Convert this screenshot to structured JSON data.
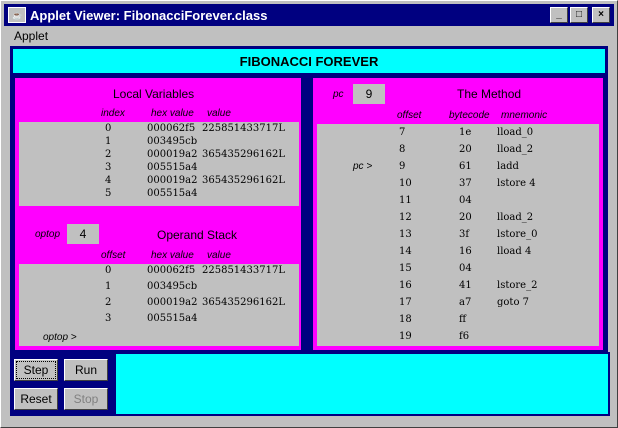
{
  "window": {
    "title": "Applet Viewer: FibonacciForever.class",
    "icon": "java-applet-icon",
    "controls": {
      "minimize": "_",
      "maximize": "□",
      "close": "×"
    }
  },
  "menu": {
    "applet": "Applet"
  },
  "banner": "FIBONACCI FOREVER",
  "local_vars": {
    "title": "Local Variables",
    "headers": {
      "index": "index",
      "hex": "hex value",
      "value": "value"
    },
    "rows": [
      {
        "index": "0",
        "hex": "000062f5",
        "value": "225851433717L"
      },
      {
        "index": "1",
        "hex": "003495cb",
        "value": ""
      },
      {
        "index": "2",
        "hex": "000019a2",
        "value": "365435296162L"
      },
      {
        "index": "3",
        "hex": "005515a4",
        "value": ""
      },
      {
        "index": "4",
        "hex": "000019a2",
        "value": "365435296162L"
      },
      {
        "index": "5",
        "hex": "005515a4",
        "value": ""
      }
    ]
  },
  "operand_stack": {
    "title": "Operand Stack",
    "optop_label": "optop",
    "optop_value": "4",
    "pointer_label": "optop >",
    "headers": {
      "offset": "offset",
      "hex": "hex value",
      "value": "value"
    },
    "rows": [
      {
        "offset": "0",
        "hex": "000062f5",
        "value": "225851433717L"
      },
      {
        "offset": "1",
        "hex": "003495cb",
        "value": ""
      },
      {
        "offset": "2",
        "hex": "000019a2",
        "value": "365435296162L"
      },
      {
        "offset": "3",
        "hex": "005515a4",
        "value": ""
      }
    ]
  },
  "method": {
    "title": "The Method",
    "pc_label": "pc",
    "pc_value": "9",
    "pointer_label": "pc >",
    "headers": {
      "offset": "offset",
      "bytecode": "bytecode",
      "mnemonic": "mnemonic"
    },
    "rows": [
      {
        "offset": "7",
        "bytecode": "1e",
        "mnemonic": "lload_0"
      },
      {
        "offset": "8",
        "bytecode": "20",
        "mnemonic": "lload_2"
      },
      {
        "offset": "9",
        "bytecode": "61",
        "mnemonic": "ladd"
      },
      {
        "offset": "10",
        "bytecode": "37",
        "mnemonic": "lstore 4"
      },
      {
        "offset": "11",
        "bytecode": "04",
        "mnemonic": ""
      },
      {
        "offset": "12",
        "bytecode": "20",
        "mnemonic": "lload_2"
      },
      {
        "offset": "13",
        "bytecode": "3f",
        "mnemonic": "lstore_0"
      },
      {
        "offset": "14",
        "bytecode": "16",
        "mnemonic": "lload 4"
      },
      {
        "offset": "15",
        "bytecode": "04",
        "mnemonic": ""
      },
      {
        "offset": "16",
        "bytecode": "41",
        "mnemonic": "lstore_2"
      },
      {
        "offset": "17",
        "bytecode": "a7",
        "mnemonic": "goto 7"
      },
      {
        "offset": "18",
        "bytecode": "ff",
        "mnemonic": ""
      },
      {
        "offset": "19",
        "bytecode": "f6",
        "mnemonic": ""
      }
    ]
  },
  "buttons": {
    "step": "Step",
    "run": "Run",
    "reset": "Reset",
    "stop": "Stop"
  },
  "colors": {
    "background": "#000080",
    "panel": "#ff00ff",
    "banner": "#00ffff",
    "grid": "#c0c0c0"
  }
}
